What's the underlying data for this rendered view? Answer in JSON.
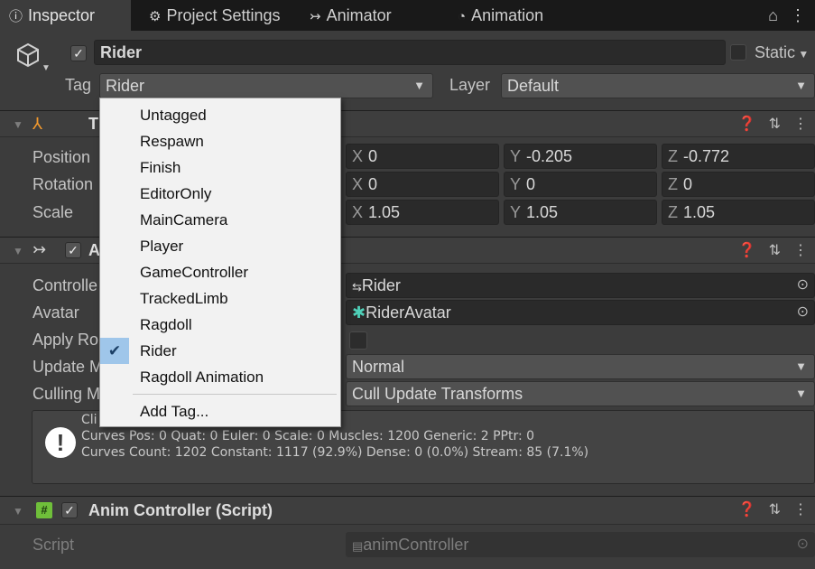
{
  "tabs": [
    {
      "icon": "info-icon",
      "glyph": "ⓘ",
      "label": "Inspector"
    },
    {
      "icon": "gear-icon",
      "glyph": "⚙",
      "label": "Project Settings"
    },
    {
      "icon": "animator-icon",
      "glyph": "↣",
      "label": "Animator"
    },
    {
      "icon": "animation-clock-icon",
      "glyph": "◔",
      "label": "Animation"
    }
  ],
  "object": {
    "active": true,
    "name": "Rider",
    "static_label": "Static",
    "tag_label": "Tag",
    "tag_value": "Rider",
    "layer_label": "Layer",
    "layer_value": "Default"
  },
  "transform": {
    "title": "T",
    "rows": [
      {
        "label": "Position",
        "x": "0",
        "y": "-0.205",
        "z": "-0.772"
      },
      {
        "label": "Rotation",
        "x": "0",
        "y": "0",
        "z": "0"
      },
      {
        "label": "Scale",
        "x": "1.05",
        "y": "1.05",
        "z": "1.05"
      }
    ],
    "axes": {
      "x": "X",
      "y": "Y",
      "z": "Z"
    }
  },
  "animator": {
    "title": "A",
    "controller_label": "Controlle",
    "controller_value": "Rider",
    "avatar_label": "Avatar",
    "avatar_value": "RiderAvatar",
    "apply_root_label": "Apply Ro",
    "update_label": "Update M",
    "update_value": "Normal",
    "culling_label": "Culling M",
    "culling_value": "Cull Update Transforms",
    "info_clip": "Cli",
    "info_line1": "Curves Pos: 0 Quat: 0 Euler: 0 Scale: 0 Muscles: 1200 Generic: 2 PPtr: 0",
    "info_line2": "Curves Count: 1202 Constant: 1117 (92.9%) Dense: 0 (0.0%) Stream: 85 (7.1%)"
  },
  "script_component": {
    "title": "Anim Controller (Script)",
    "script_label": "Script",
    "script_value": "animController"
  },
  "tag_menu": {
    "items": [
      "Untagged",
      "Respawn",
      "Finish",
      "EditorOnly",
      "MainCamera",
      "Player",
      "GameController",
      "TrackedLimb",
      "Ragdoll",
      "Rider",
      "Ragdoll Animation"
    ],
    "selected": "Rider",
    "add_label": "Add Tag..."
  },
  "colors": {
    "background": "#3c3c3c",
    "field": "#2a2a2a",
    "menu": "#f2f2f2",
    "selection": "#9fc6ea"
  }
}
